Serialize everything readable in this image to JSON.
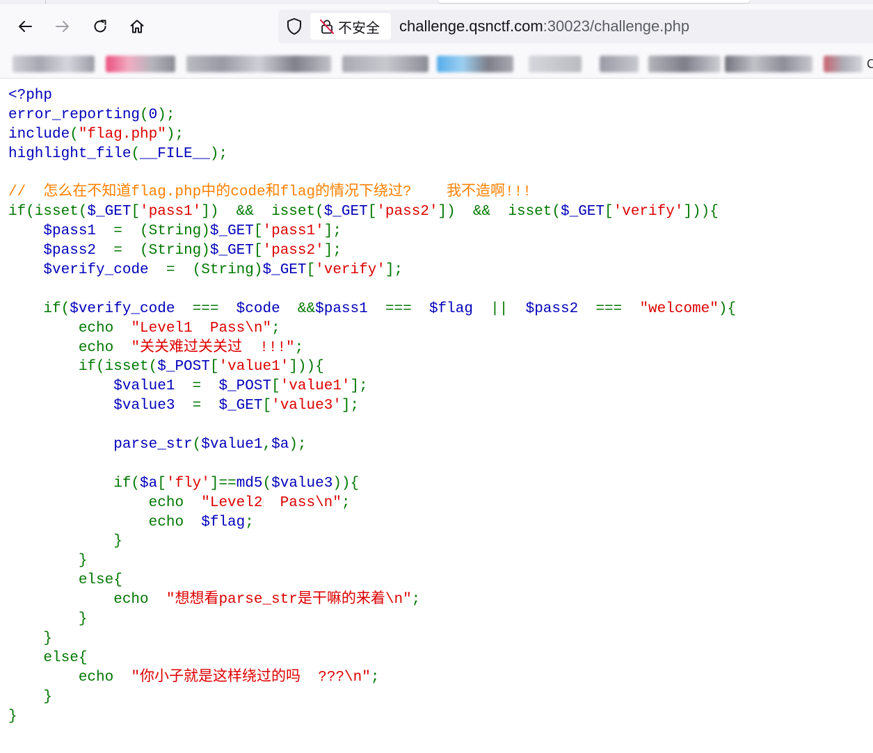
{
  "browser": {
    "security_label": "不安全",
    "url_host": "challenge.qsnctf.com",
    "url_port": ":30023",
    "url_path": "/challenge.php",
    "icons": [
      "back-arrow-icon",
      "forward-arrow-icon",
      "reload-icon",
      "home-icon",
      "tracking-shield-icon",
      "insecure-lock-icon"
    ],
    "bookmark_edge_letter": "C"
  },
  "code_lines": [
    [
      [
        "d",
        "<?php"
      ]
    ],
    [
      [
        "d",
        "error_reporting"
      ],
      [
        "k",
        "("
      ],
      [
        "d",
        "0"
      ],
      [
        "k",
        ");"
      ]
    ],
    [
      [
        "d",
        "include"
      ],
      [
        "k",
        "("
      ],
      [
        "s",
        "\"flag.php\""
      ],
      [
        "k",
        ");"
      ]
    ],
    [
      [
        "d",
        "highlight_file"
      ],
      [
        "k",
        "("
      ],
      [
        "d",
        "__FILE__"
      ],
      [
        "k",
        ");"
      ]
    ],
    [],
    [
      [
        "c",
        "//  怎么在不知道flag.php中的code和flag的情况下绕过?    我不造啊!!!"
      ]
    ],
    [
      [
        "k",
        "if(isset("
      ],
      [
        "d",
        "$_GET"
      ],
      [
        "k",
        "["
      ],
      [
        "s",
        "'pass1'"
      ],
      [
        "k",
        "])  &&  isset("
      ],
      [
        "d",
        "$_GET"
      ],
      [
        "k",
        "["
      ],
      [
        "s",
        "'pass2'"
      ],
      [
        "k",
        "])  &&  isset("
      ],
      [
        "d",
        "$_GET"
      ],
      [
        "k",
        "["
      ],
      [
        "s",
        "'verify'"
      ],
      [
        "k",
        "])){"
      ]
    ],
    [
      [
        "k",
        "    "
      ],
      [
        "d",
        "$pass1  "
      ],
      [
        "k",
        "=  (String)"
      ],
      [
        "d",
        "$_GET"
      ],
      [
        "k",
        "["
      ],
      [
        "s",
        "'pass1'"
      ],
      [
        "k",
        "];"
      ]
    ],
    [
      [
        "k",
        "    "
      ],
      [
        "d",
        "$pass2  "
      ],
      [
        "k",
        "=  (String)"
      ],
      [
        "d",
        "$_GET"
      ],
      [
        "k",
        "["
      ],
      [
        "s",
        "'pass2'"
      ],
      [
        "k",
        "];"
      ]
    ],
    [
      [
        "k",
        "    "
      ],
      [
        "d",
        "$verify_code  "
      ],
      [
        "k",
        "=  (String)"
      ],
      [
        "d",
        "$_GET"
      ],
      [
        "k",
        "["
      ],
      [
        "s",
        "'verify'"
      ],
      [
        "k",
        "];"
      ]
    ],
    [],
    [
      [
        "k",
        "    if("
      ],
      [
        "d",
        "$verify_code  "
      ],
      [
        "k",
        "===  "
      ],
      [
        "d",
        "$code  "
      ],
      [
        "k",
        "&&"
      ],
      [
        "d",
        "$pass1  "
      ],
      [
        "k",
        "===  "
      ],
      [
        "d",
        "$flag  "
      ],
      [
        "k",
        "||  "
      ],
      [
        "d",
        "$pass2  "
      ],
      [
        "k",
        "===  "
      ],
      [
        "s",
        "\"welcome\""
      ],
      [
        "k",
        "){"
      ]
    ],
    [
      [
        "k",
        "        echo  "
      ],
      [
        "s",
        "\"Level1  Pass\\n\""
      ],
      [
        "k",
        ";"
      ]
    ],
    [
      [
        "k",
        "        echo  "
      ],
      [
        "s",
        "\"关关难过关关过  !!!\""
      ],
      [
        "k",
        ";"
      ]
    ],
    [
      [
        "k",
        "        if(isset("
      ],
      [
        "d",
        "$_POST"
      ],
      [
        "k",
        "["
      ],
      [
        "s",
        "'value1'"
      ],
      [
        "k",
        "])){"
      ]
    ],
    [
      [
        "k",
        "            "
      ],
      [
        "d",
        "$value1  "
      ],
      [
        "k",
        "=  "
      ],
      [
        "d",
        "$_POST"
      ],
      [
        "k",
        "["
      ],
      [
        "s",
        "'value1'"
      ],
      [
        "k",
        "];"
      ]
    ],
    [
      [
        "k",
        "            "
      ],
      [
        "d",
        "$value3  "
      ],
      [
        "k",
        "=  "
      ],
      [
        "d",
        "$_GET"
      ],
      [
        "k",
        "["
      ],
      [
        "s",
        "'value3'"
      ],
      [
        "k",
        "];"
      ]
    ],
    [],
    [
      [
        "k",
        "            "
      ],
      [
        "d",
        "parse_str"
      ],
      [
        "k",
        "("
      ],
      [
        "d",
        "$value1"
      ],
      [
        "k",
        ","
      ],
      [
        "d",
        "$a"
      ],
      [
        "k",
        ");"
      ]
    ],
    [],
    [
      [
        "k",
        "            if("
      ],
      [
        "d",
        "$a"
      ],
      [
        "k",
        "["
      ],
      [
        "s",
        "'fly'"
      ],
      [
        "k",
        "]=="
      ],
      [
        "d",
        "md5"
      ],
      [
        "k",
        "("
      ],
      [
        "d",
        "$value3"
      ],
      [
        "k",
        ")){"
      ]
    ],
    [
      [
        "k",
        "                echo  "
      ],
      [
        "s",
        "\"Level2  Pass\\n\""
      ],
      [
        "k",
        ";"
      ]
    ],
    [
      [
        "k",
        "                echo  "
      ],
      [
        "d",
        "$flag"
      ],
      [
        "k",
        ";"
      ]
    ],
    [
      [
        "k",
        "            }"
      ]
    ],
    [
      [
        "k",
        "        }"
      ]
    ],
    [
      [
        "k",
        "        else{"
      ]
    ],
    [
      [
        "k",
        "            echo  "
      ],
      [
        "s",
        "\"想想看parse_str是干嘛的来着\\n\""
      ],
      [
        "k",
        ";"
      ]
    ],
    [
      [
        "k",
        "        }"
      ]
    ],
    [
      [
        "k",
        "    }"
      ]
    ],
    [
      [
        "k",
        "    else{"
      ]
    ],
    [
      [
        "k",
        "        echo  "
      ],
      [
        "s",
        "\"你小子就是这样绕过的吗  ???\\n\""
      ],
      [
        "k",
        ";"
      ]
    ],
    [
      [
        "k",
        "    }"
      ]
    ],
    [
      [
        "k",
        "}"
      ]
    ]
  ],
  "colors": {
    "keyword": "#007700",
    "default": "#0000bb",
    "string": "#dd0000",
    "comment": "#ff8000"
  }
}
